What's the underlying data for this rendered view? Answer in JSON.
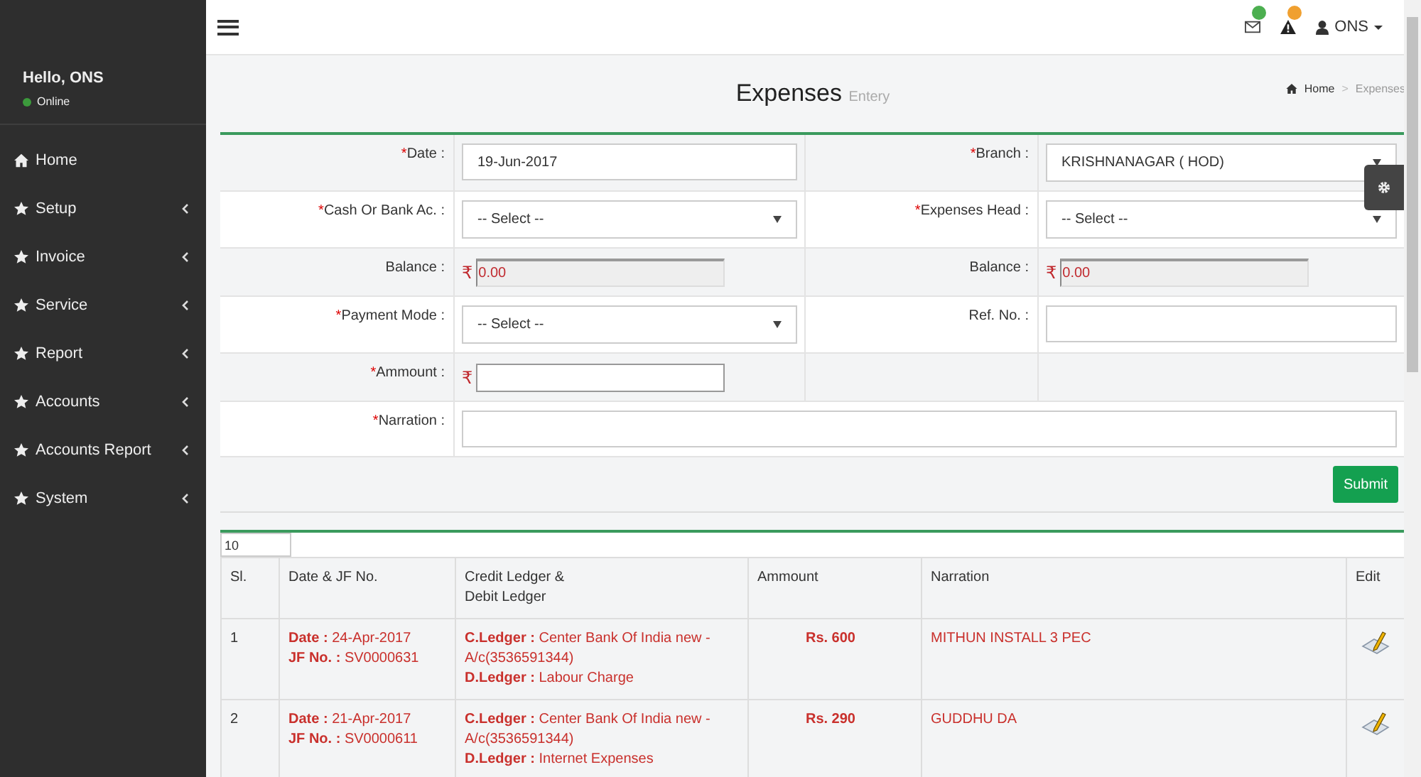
{
  "sidebar": {
    "greeting": "Hello, ONS",
    "status": "Online",
    "items": [
      {
        "label": "Home",
        "kind": "home",
        "has_submenu": false
      },
      {
        "label": "Setup",
        "kind": "star",
        "has_submenu": true
      },
      {
        "label": "Invoice",
        "kind": "star",
        "has_submenu": true
      },
      {
        "label": "Service",
        "kind": "star",
        "has_submenu": true
      },
      {
        "label": "Report",
        "kind": "star",
        "has_submenu": true
      },
      {
        "label": "Accounts",
        "kind": "star",
        "has_submenu": true
      },
      {
        "label": "Accounts Report",
        "kind": "star",
        "has_submenu": true
      },
      {
        "label": "System",
        "kind": "star",
        "has_submenu": true
      }
    ]
  },
  "topbar": {
    "notifications": [
      {
        "kind": "mail",
        "color": "#4caf50"
      },
      {
        "kind": "warning",
        "color": "#f0a030"
      }
    ],
    "user": "ONS"
  },
  "page": {
    "title": "Expenses",
    "subtitle": "Entery",
    "breadcrumb": [
      "Home",
      ">",
      "Expenses"
    ]
  },
  "form": {
    "rows": [
      {
        "kind": "pair",
        "fields": [
          {
            "mark": "*",
            "label": "Date :",
            "kind": "text",
            "value": "19-Jun-2017"
          },
          {
            "mark": "*",
            "label": "Branch :",
            "kind": "select",
            "value": "KRISHNANAGAR ( HOD)"
          }
        ]
      },
      {
        "kind": "pair",
        "fields": [
          {
            "mark": "*",
            "label": "Cash Or Bank Ac. :",
            "kind": "select",
            "value": "-- Select --"
          },
          {
            "mark": "*",
            "label": "Expenses Head :",
            "kind": "select",
            "value": "-- Select --"
          }
        ]
      },
      {
        "kind": "pair",
        "fields": [
          {
            "label": "Balance :",
            "kind": "currency",
            "currency": "₹",
            "value": "0.00",
            "readonly": true
          },
          {
            "label": "Balance :",
            "kind": "currency",
            "currency": "₹",
            "value": "0.00",
            "readonly": true
          }
        ]
      },
      {
        "kind": "pair",
        "fields": [
          {
            "mark": "*",
            "label": "Payment Mode :",
            "kind": "select",
            "value": "-- Select --"
          },
          {
            "label": "Ref. No. :",
            "kind": "text"
          }
        ]
      },
      {
        "kind": "pair",
        "fields": [
          {
            "mark": "*",
            "label": "Ammount :",
            "kind": "currency",
            "currency": "₹",
            "readonly": false
          }
        ]
      },
      {
        "kind": "full",
        "fields": [
          {
            "mark": "*",
            "label": "Narration :",
            "kind": "text"
          }
        ]
      }
    ],
    "submit": "Submit"
  },
  "table": {
    "page_size": "10",
    "columns": [
      "Sl.",
      "Date & JF No.",
      "Credit Ledger &\nDebit Ledger",
      "Ammount",
      "Narration",
      "Edit"
    ],
    "rows": [
      {
        "sl": "1",
        "date": [
          "**Date :** 24-Apr-2017",
          "**JF No. :** SV0000631"
        ],
        "ledger": [
          "**C.Ledger :** Center Bank Of India new - A/c(3536591344)",
          "**D.Ledger :** Labour Charge"
        ],
        "amount": "Rs. 600",
        "narration": "MITHUN INSTALL 3 PEC"
      },
      {
        "sl": "2",
        "date": [
          "**Date :** 21-Apr-2017",
          "**JF No. :** SV0000611"
        ],
        "ledger": [
          "**C.Ledger :** Center Bank Of India new - A/c(3536591344)",
          "**D.Ledger :** Internet Expenses"
        ],
        "amount": "Rs. 290",
        "narration": "GUDDHU DA"
      }
    ]
  }
}
